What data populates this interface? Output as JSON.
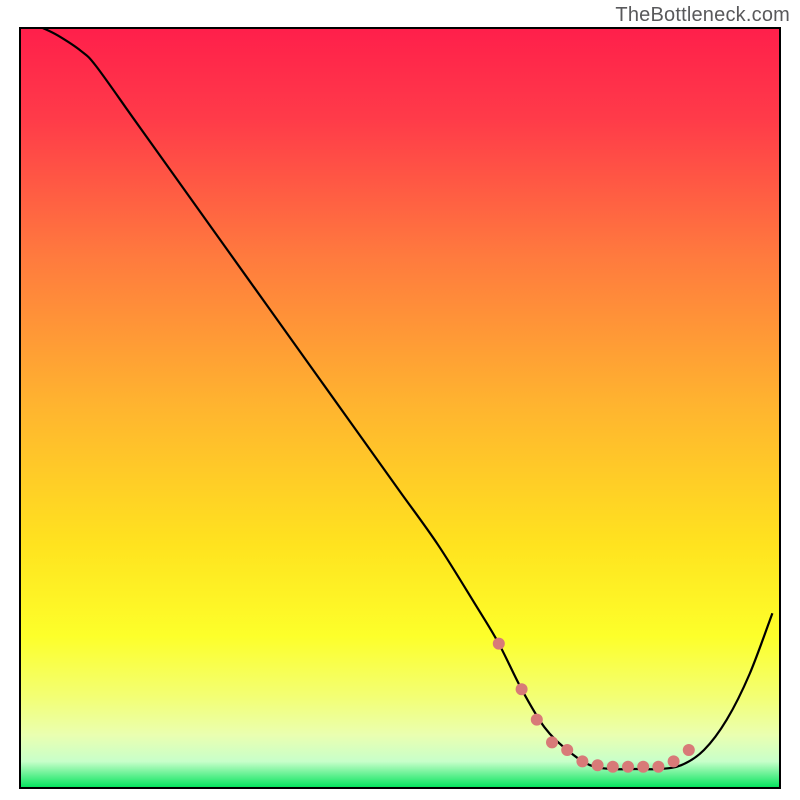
{
  "watermark": "TheBottleneck.com",
  "chart_data": {
    "type": "line",
    "title": "",
    "xlabel": "",
    "ylabel": "",
    "xlim": [
      0,
      100
    ],
    "ylim": [
      0,
      100
    ],
    "background_gradient": {
      "stops": [
        {
          "offset": 0.0,
          "color": "#ff1f4b"
        },
        {
          "offset": 0.12,
          "color": "#ff3b49"
        },
        {
          "offset": 0.3,
          "color": "#ff7a3e"
        },
        {
          "offset": 0.5,
          "color": "#ffb52f"
        },
        {
          "offset": 0.68,
          "color": "#ffe31f"
        },
        {
          "offset": 0.8,
          "color": "#fdff2a"
        },
        {
          "offset": 0.88,
          "color": "#f3ff74"
        },
        {
          "offset": 0.93,
          "color": "#eaffb0"
        },
        {
          "offset": 0.965,
          "color": "#c8ffca"
        },
        {
          "offset": 1.0,
          "color": "#00e35b"
        }
      ]
    },
    "series": [
      {
        "name": "bottleneck-curve",
        "color": "#000000",
        "x": [
          3,
          5,
          8,
          10,
          15,
          20,
          25,
          30,
          35,
          40,
          45,
          50,
          55,
          60,
          63,
          66,
          69,
          72,
          75,
          78,
          81,
          84,
          87,
          90,
          93,
          96,
          99
        ],
        "y": [
          100,
          99,
          97,
          95,
          88,
          81,
          74,
          67,
          60,
          53,
          46,
          39,
          32,
          24,
          19,
          13,
          8,
          5,
          3,
          2.5,
          2.5,
          2.5,
          3,
          5,
          9,
          15,
          23
        ]
      }
    ],
    "markers": {
      "name": "valley-points",
      "color": "#d87a78",
      "radius": 6,
      "x": [
        63,
        66,
        68,
        70,
        72,
        74,
        76,
        78,
        80,
        82,
        84,
        86,
        88
      ],
      "y": [
        19,
        13,
        9,
        6,
        5,
        3.5,
        3,
        2.8,
        2.8,
        2.8,
        2.8,
        3.5,
        5
      ]
    }
  }
}
